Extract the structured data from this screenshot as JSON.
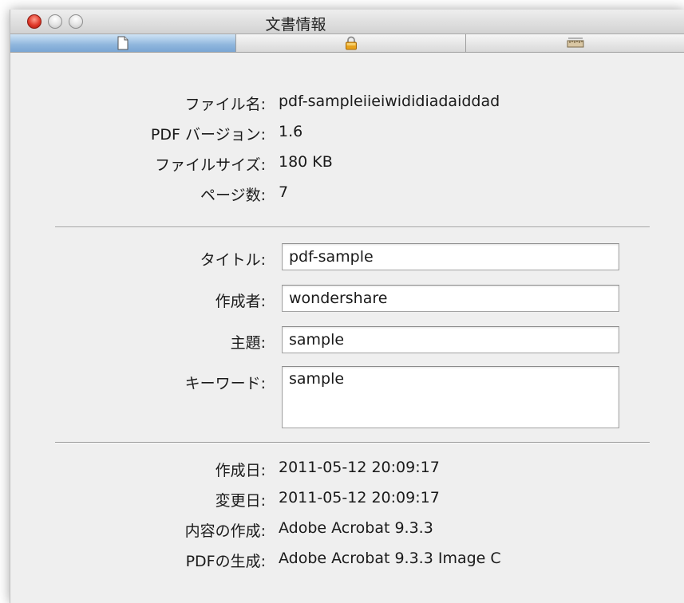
{
  "window": {
    "title": "文書情報"
  },
  "tabs": [
    {
      "icon": "document-icon",
      "selected": true
    },
    {
      "icon": "lock-icon",
      "selected": false
    },
    {
      "icon": "ruler-icon",
      "selected": false
    }
  ],
  "info": {
    "filename_label": "ファイル名:",
    "filename_value": "pdf-sampleiieiwididiadaiddad",
    "pdfversion_label": "PDF バージョン:",
    "pdfversion_value": "1.6",
    "filesize_label": "ファイルサイズ:",
    "filesize_value": "180 KB",
    "pages_label": "ページ数:",
    "pages_value": "7"
  },
  "meta": {
    "title_label": "タイトル:",
    "title_value": "pdf-sample",
    "author_label": "作成者:",
    "author_value": "wondershare",
    "subject_label": "主題:",
    "subject_value": "sample",
    "keywords_label": "キーワード:",
    "keywords_value": "sample"
  },
  "dates": {
    "created_label": "作成日:",
    "created_value": "2011-05-12 20:09:17",
    "modified_label": "変更日:",
    "modified_value": "2011-05-12 20:09:17",
    "creator_label": "内容の作成:",
    "creator_value": "Adobe Acrobat 9.3.3",
    "producer_label": "PDFの生成:",
    "producer_value": "Adobe Acrobat 9.3.3 Image C"
  },
  "colors": {
    "close_button": "#e0392a",
    "selected_tab": "#8fb6dd",
    "window_bg": "#efefef"
  }
}
